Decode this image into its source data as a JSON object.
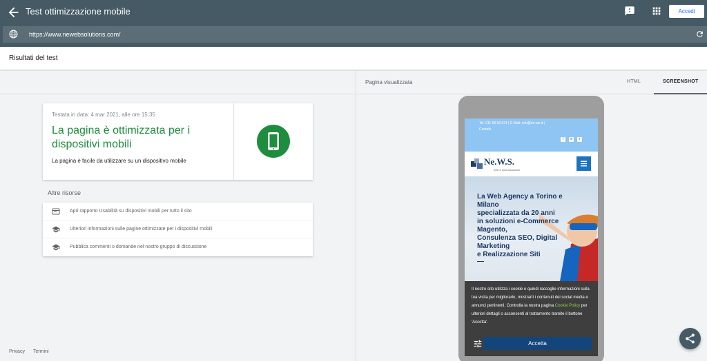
{
  "header": {
    "title": "Test ottimizzazione mobile",
    "signin_label": "Accedi"
  },
  "urlbar": {
    "url": "https://www.newebsolutions.com/"
  },
  "results": {
    "title": "Risultati del test"
  },
  "card": {
    "tested_on": "Testata in data: 4 mar 2021, alle ore 15:35",
    "headline": "La pagina è ottimizzata per i dispositivi mobili",
    "subtitle": "La pagina è facile da utilizzare su un dispositivo mobile"
  },
  "resources": {
    "title": "Altre risorse",
    "items": [
      {
        "label": "Apri rapporto Usabilità su dispositivi mobili per tutto il sito",
        "icon": "report-icon"
      },
      {
        "label": "Ulteriori informazioni sulle pagine ottimizzate per i dispositivi mobili",
        "icon": "school-icon"
      },
      {
        "label": "Pubblica commenti o domande nel nostro gruppo di discussione",
        "icon": "school-icon"
      }
    ]
  },
  "footer": {
    "privacy": "Privacy",
    "terms": "Termini"
  },
  "preview": {
    "label": "Pagina visualizzata",
    "tabs": [
      "HTML",
      "SCREENSHOT"
    ],
    "active_tab": "SCREENSHOT"
  },
  "site": {
    "contact_line": "Tel. 011 58 56 024 | E-Mail: info@ne-ws.it |",
    "contatti": "Contatti",
    "social": [
      "f",
      "in",
      "t"
    ],
    "logo": "Ne.W.S.",
    "logo_sub": "web e comunicazione",
    "hero_lines": [
      "La Web Agency a Torino e",
      "Milano",
      "specializzata da 20 anni",
      "in soluzioni e-Commerce",
      "Magento,",
      "Consulenza SEO, Digital",
      "Marketing",
      "e Realizzazione Siti",
      "—"
    ],
    "cookie_text_before": "Il nostro sito utilizza i cookie e quindi raccoglie informazioni sulla tua visita per migliorarlo, mostrarti i contenuti dei social media e annunci pertinenti. Controlla la nostra pagina ",
    "cookie_link": "Cookie Policy",
    "cookie_text_after": " per ulteriori dettagli o acconsenti al trattamento tramite il bottone 'Accetta'.",
    "accept_label": "Accetta"
  },
  "colors": {
    "header_bg": "#455a64",
    "success_green": "#1e8e3e",
    "brand_blue": "#1e73be"
  }
}
